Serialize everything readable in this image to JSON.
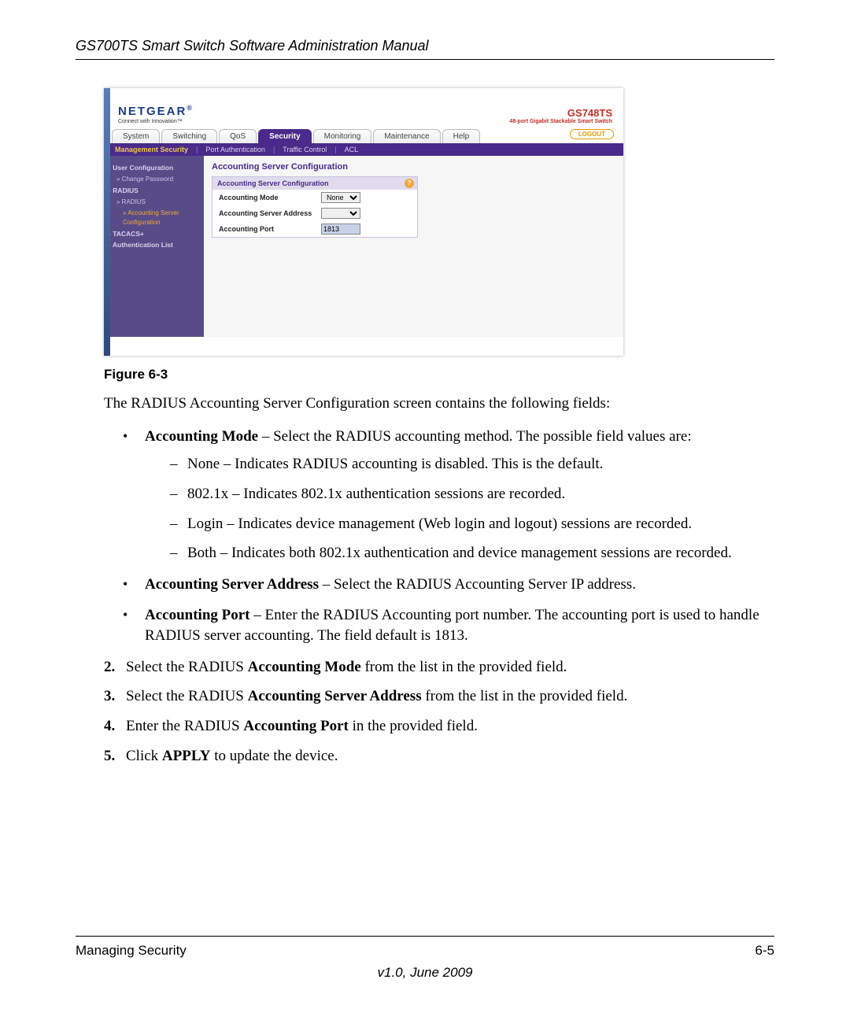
{
  "doc": {
    "header": "GS700TS Smart Switch Software Administration Manual",
    "figure_caption": "Figure 6-3",
    "intro": "The RADIUS Accounting Server Configuration screen contains the following fields:",
    "bullets": [
      {
        "lead": "Accounting Mode",
        "rest": " – Select the RADIUS accounting method. The possible field values are:",
        "sub": [
          "None – Indicates RADIUS accounting is disabled. This is the default.",
          "802.1x – Indicates 802.1x authentication sessions are recorded.",
          "Login – Indicates device management (Web login and logout) sessions are recorded.",
          "Both – Indicates both 802.1x authentication and device management sessions are recorded."
        ]
      },
      {
        "lead": "Accounting Server Address",
        "rest": " – Select the RADIUS Accounting Server IP address."
      },
      {
        "lead": "Accounting Port",
        "rest": " – Enter the RADIUS Accounting port number. The accounting port is used to handle RADIUS server accounting. The field default is 1813."
      }
    ],
    "steps": [
      {
        "n": "2.",
        "pre": "Select the RADIUS ",
        "bold": "Accounting Mode",
        "post": " from the list in the provided field."
      },
      {
        "n": "3.",
        "pre": "Select the RADIUS ",
        "bold": "Accounting Server Address",
        "post": " from the list in the provided field."
      },
      {
        "n": "4.",
        "pre": "Enter the RADIUS ",
        "bold": "Accounting Port",
        "post": " in the provided field."
      },
      {
        "n": "5.",
        "pre": "Click ",
        "bold": "APPLY",
        "post": " to update the device."
      }
    ],
    "footer_left": "Managing Security",
    "footer_right": "6-5",
    "footer_version": "v1.0, June 2009"
  },
  "ss": {
    "brand": "NETGEAR",
    "brand_tag": "Connect with Innovation™",
    "model_num": "GS748TS",
    "model_tag": "48-port Gigabit Stackable Smart Switch",
    "tabs": [
      "System",
      "Switching",
      "QoS",
      "Security",
      "Monitoring",
      "Maintenance",
      "Help"
    ],
    "active_tab_index": 3,
    "logout": "LOGOUT",
    "subnav": [
      "Management Security",
      "Port Authentication",
      "Traffic Control",
      "ACL"
    ],
    "subnav_active_index": 0,
    "sidebar": {
      "user_cfg": "User Configuration",
      "change_pw": "Change Password",
      "radius_root": "RADIUS",
      "radius": "RADIUS",
      "acct_srv_cfg": "Accounting Server Configuration",
      "tacacs": "TACACS+",
      "auth_list": "Authentication List"
    },
    "panel": {
      "title": "Accounting Server Configuration",
      "section": "Accounting Server Configuration",
      "row_mode_label": "Accounting Mode",
      "row_mode_value": "None",
      "row_addr_label": "Accounting Server Address",
      "row_port_label": "Accounting Port",
      "row_port_value": "1813"
    }
  }
}
